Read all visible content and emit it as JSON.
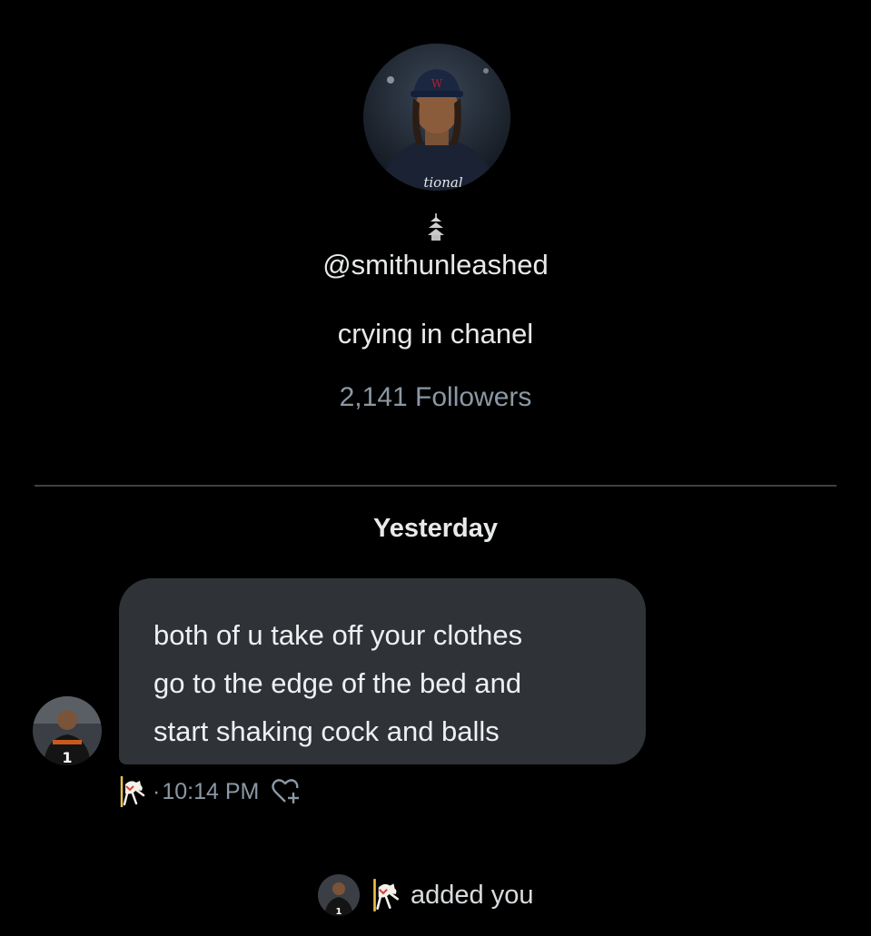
{
  "profile": {
    "handle": "@smithunleashed",
    "bio": "crying in chanel",
    "followers": "2,141 Followers",
    "avatar_icon": "profile-photo-icon",
    "badge_icon": "pagoda-emoji-icon"
  },
  "conversation": {
    "date_separator": "Yesterday",
    "message": {
      "lines": [
        "both of u take off your clothes",
        "go to the edge of the bed and",
        "start shaking cock and balls"
      ],
      "time": "10:14 PM",
      "separator": "·",
      "sender_icon": "carousel-horse-emoji-icon",
      "react_icon": "heart-plus-icon"
    },
    "system_event": {
      "text": "added you",
      "actor_icon": "carousel-horse-emoji-icon"
    }
  },
  "colors": {
    "background": "#000000",
    "bubble": "#2f3337",
    "text_primary": "#e7e9ea",
    "text_secondary": "#8b98a5",
    "divider": "#3e4144"
  }
}
